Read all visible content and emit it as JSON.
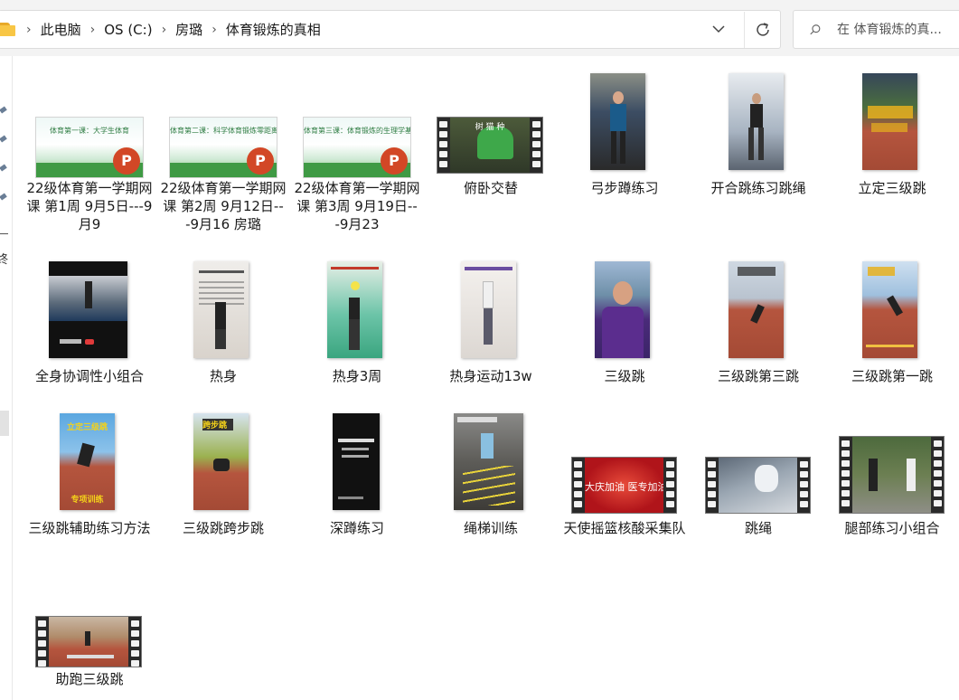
{
  "address": {
    "crumbs": [
      "此电脑",
      "OS (C:)",
      "房璐",
      "体育锻炼的真相"
    ]
  },
  "search": {
    "placeholder": "在 体育锻炼的真..."
  },
  "leftnav": {
    "fragment": "终"
  },
  "files": [
    {
      "name": "22级体育第一学期网课 第1周 9月5日---9月9",
      "type": "ppt",
      "thumb_title": "体育第一课：大学生体育"
    },
    {
      "name": "22级体育第一学期网课 第2周 9月12日---9月16 房璐",
      "type": "ppt",
      "thumb_title": "体育第二课：科学体育锻炼零距离"
    },
    {
      "name": "22级体育第一学期网课 第3周 9月19日---9月23",
      "type": "ppt",
      "thumb_title": "体育第三课：体育锻炼的生理学基础"
    },
    {
      "name": "俯卧交替",
      "type": "film",
      "thumb_text": "树 猫 种"
    },
    {
      "name": "弓步蹲练习",
      "type": "video"
    },
    {
      "name": "开合跳练习跳绳",
      "type": "video"
    },
    {
      "name": "立定三级跳",
      "type": "video"
    },
    {
      "name": "全身协调性小组合",
      "type": "video"
    },
    {
      "name": "热身",
      "type": "video"
    },
    {
      "name": "热身3周",
      "type": "video"
    },
    {
      "name": "热身运动13w",
      "type": "video"
    },
    {
      "name": "三级跳",
      "type": "video"
    },
    {
      "name": "三级跳第三跳",
      "type": "video"
    },
    {
      "name": "三级跳第一跳",
      "type": "video"
    },
    {
      "name": "三级跳辅助练习方法",
      "type": "video",
      "thumb_text_top": "立定三级跳",
      "thumb_text_bottom": "专项训练"
    },
    {
      "name": "三级跳跨步跳",
      "type": "video",
      "thumb_text_top": "跨步跳"
    },
    {
      "name": "深蹲练习",
      "type": "video"
    },
    {
      "name": "绳梯训练",
      "type": "video"
    },
    {
      "name": "天使摇篮核酸采集队",
      "type": "film",
      "thumb_text": "大庆加油 医专加油"
    },
    {
      "name": "跳绳",
      "type": "film"
    },
    {
      "name": "腿部练习小组合",
      "type": "film"
    },
    {
      "name": "助跑三级跳",
      "type": "film"
    }
  ],
  "colors": {
    "ppt_logo": "#d24726",
    "folder": "#f8c645",
    "track": "#b5553e"
  }
}
